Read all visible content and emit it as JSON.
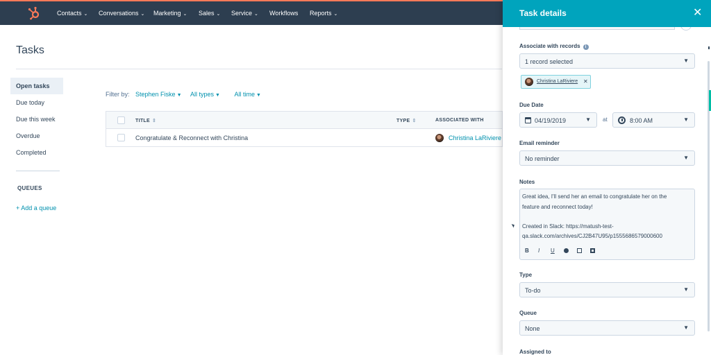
{
  "nav": {
    "items": [
      {
        "label": "Contacts",
        "has_dropdown": true
      },
      {
        "label": "Conversations",
        "has_dropdown": true
      },
      {
        "label": "Marketing",
        "has_dropdown": true
      },
      {
        "label": "Sales",
        "has_dropdown": true
      },
      {
        "label": "Service",
        "has_dropdown": true
      },
      {
        "label": "Workflows",
        "has_dropdown": false
      },
      {
        "label": "Reports",
        "has_dropdown": true
      }
    ],
    "brand_color": "#2d3e50",
    "accent_color": "#ff7a59",
    "logo_icon": "hubspot-sprocket-icon"
  },
  "page": {
    "title": "Tasks"
  },
  "sidebar": {
    "items": [
      {
        "label": "Open tasks",
        "active": true
      },
      {
        "label": "Due today",
        "active": false
      },
      {
        "label": "Due this week",
        "active": false
      },
      {
        "label": "Overdue",
        "active": false
      },
      {
        "label": "Completed",
        "active": false
      }
    ],
    "queues_heading": "QUEUES",
    "add_queue_label": "+ Add a queue"
  },
  "filters": {
    "label": "Filter by:",
    "owner": "Stephen Fiske",
    "types": "All types",
    "time": "All time"
  },
  "table": {
    "columns": [
      "TITLE",
      "TYPE",
      "ASSOCIATED WITH"
    ],
    "rows": [
      {
        "title": "Congratulate & Reconnect with Christina",
        "type": "",
        "associated_with": "Christina LaRiviere"
      }
    ]
  },
  "panel": {
    "title": "Task details",
    "close_icon": "close-icon",
    "header_color": "#00a4bd",
    "associate_label": "Associate with records",
    "associate_value": "1 record selected",
    "associated_chip": "Christina LaRiviere",
    "due_date_label": "Due Date",
    "due_date": "04/19/2019",
    "at_label": "at",
    "due_time": "8:00 AM",
    "email_reminder_label": "Email reminder",
    "email_reminder_value": "No reminder",
    "notes_label": "Notes",
    "notes_lines": [
      "Great idea, I'll send her an email to congratulate her on the",
      "feature and reconnect today!",
      "Created in Slack: https://matush-test-",
      "qa.slack.com/archives/CJ2B47U95/p1555686579000600"
    ],
    "notes_toolbar": [
      "B",
      "I",
      "U"
    ],
    "type_label": "Type",
    "type_value": "To-do",
    "queue_label": "Queue",
    "queue_value": "None",
    "assigned_label": "Assigned to"
  }
}
